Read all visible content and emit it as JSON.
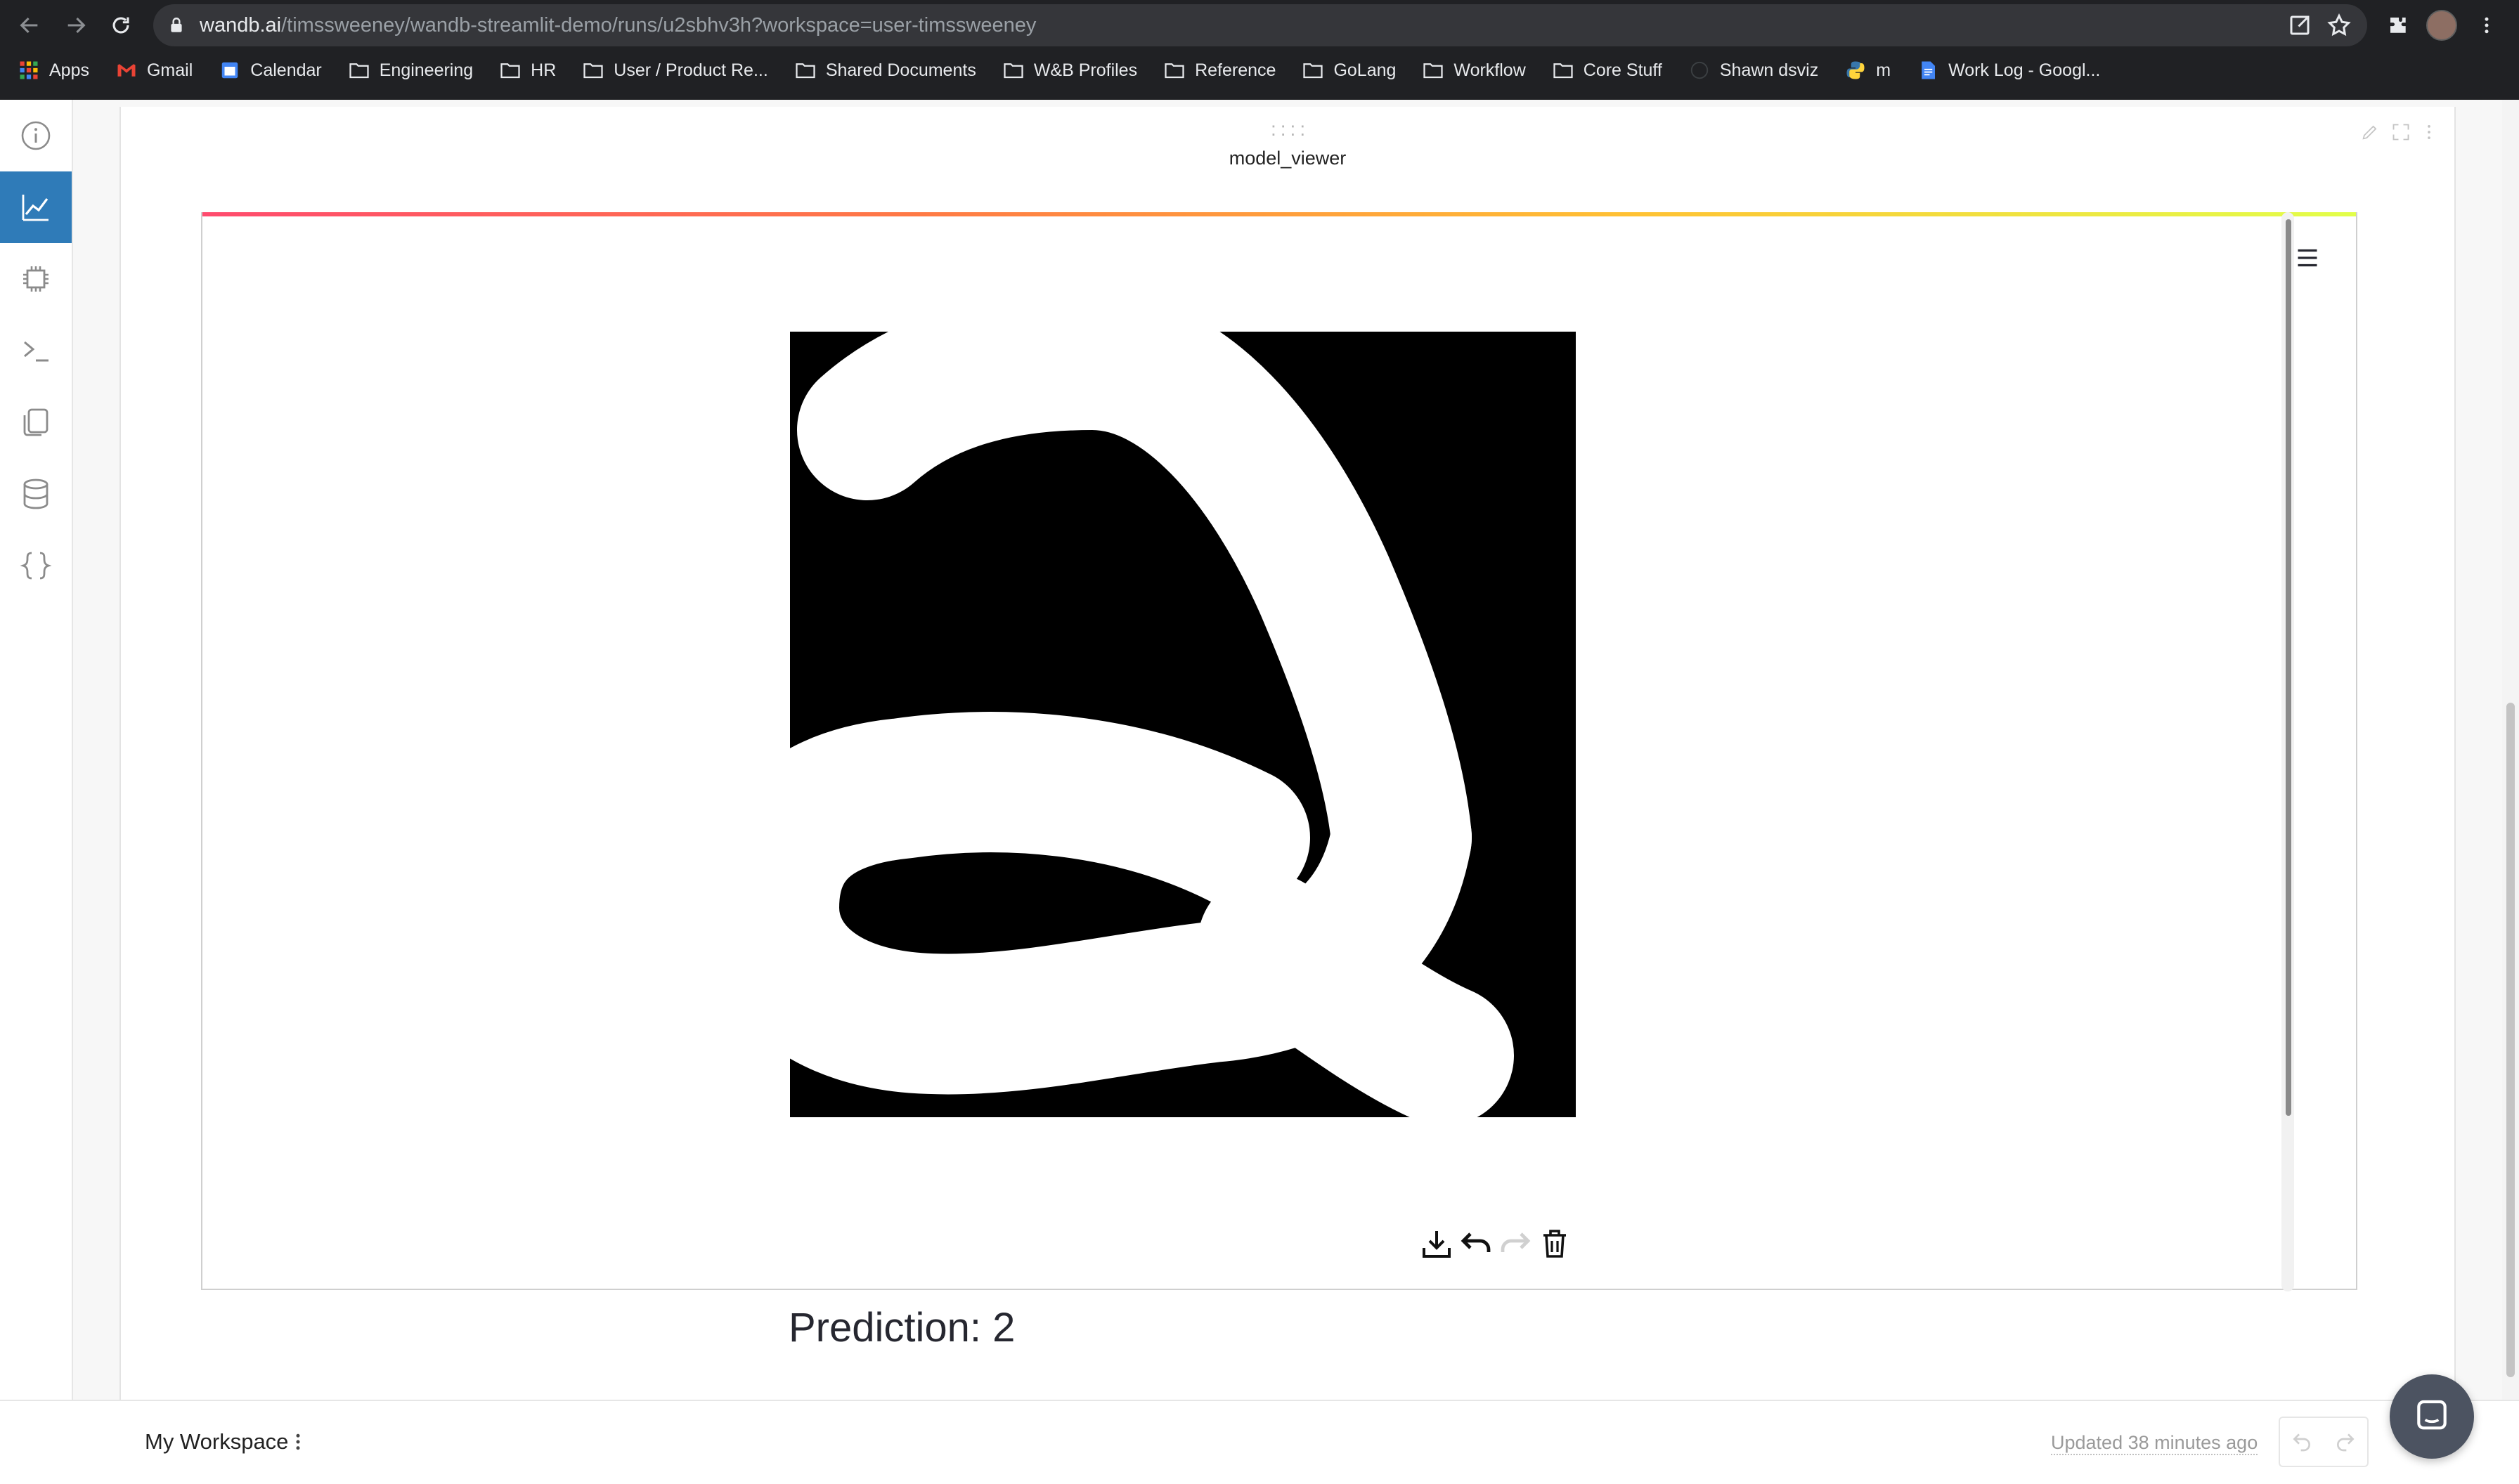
{
  "browser": {
    "url_host": "wandb.ai",
    "url_path": "/timssweeney/wandb-streamlit-demo/runs/u2sbhv3h?workspace=user-timssweeney",
    "bookmarks": [
      {
        "label": "Apps",
        "icon": "apps-grid-icon"
      },
      {
        "label": "Gmail",
        "icon": "gmail-icon"
      },
      {
        "label": "Calendar",
        "icon": "calendar-icon"
      },
      {
        "label": "Engineering",
        "icon": "folder-icon"
      },
      {
        "label": "HR",
        "icon": "folder-icon"
      },
      {
        "label": "User / Product Re...",
        "icon": "folder-icon"
      },
      {
        "label": "Shared Documents",
        "icon": "folder-icon"
      },
      {
        "label": "W&B Profiles",
        "icon": "folder-icon"
      },
      {
        "label": "Reference",
        "icon": "folder-icon"
      },
      {
        "label": "GoLang",
        "icon": "folder-icon"
      },
      {
        "label": "Workflow",
        "icon": "folder-icon"
      },
      {
        "label": "Core Stuff",
        "icon": "folder-icon"
      },
      {
        "label": "Shawn dsviz",
        "icon": "globe-icon"
      },
      {
        "label": "m",
        "icon": "python-icon"
      },
      {
        "label": "Work Log - Googl...",
        "icon": "google-docs-icon"
      }
    ]
  },
  "sidebar": {
    "items": [
      {
        "name": "overview",
        "icon": "info-icon",
        "active": false
      },
      {
        "name": "charts",
        "icon": "line-chart-icon",
        "active": true
      },
      {
        "name": "system",
        "icon": "chip-icon",
        "active": false
      },
      {
        "name": "logs",
        "icon": "terminal-icon",
        "active": false
      },
      {
        "name": "files",
        "icon": "files-icon",
        "active": false
      },
      {
        "name": "artifacts",
        "icon": "database-icon",
        "active": false
      },
      {
        "name": "code",
        "icon": "braces-icon",
        "active": false
      }
    ]
  },
  "panel": {
    "drag_handle": "::::",
    "title": "model_viewer",
    "prediction_text": "Prediction: 2"
  },
  "canvas": {
    "tools": [
      "download-icon",
      "undo-icon",
      "redo-icon",
      "trash-icon"
    ]
  },
  "footer": {
    "workspace_name": "My Workspace",
    "updated_text": "Updated 38 minutes ago"
  },
  "colors": {
    "chrome_bg": "#202124",
    "sidebar_active": "#2f7bb8",
    "canvas_bg": "#000000",
    "stroke": "#ffffff"
  }
}
